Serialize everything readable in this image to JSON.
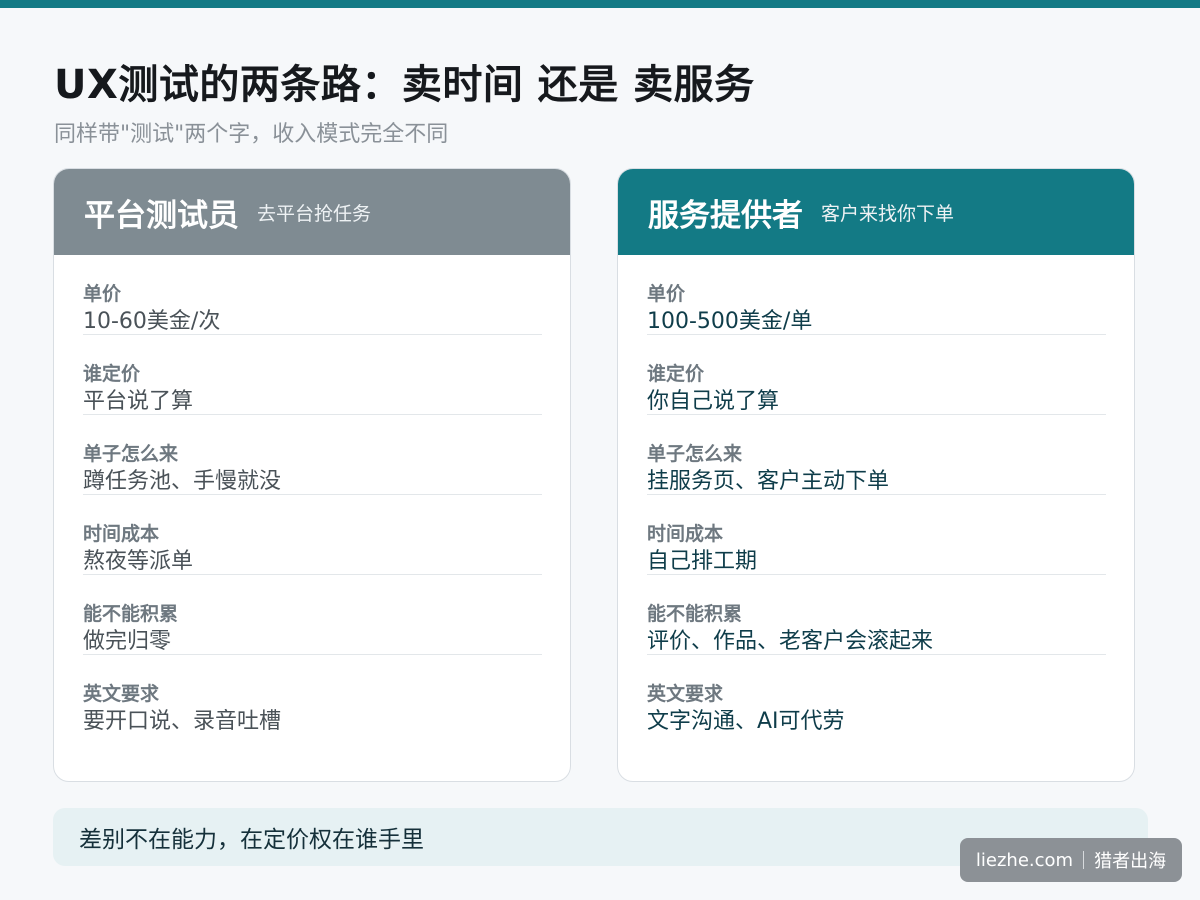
{
  "title": "UX测试的两条路：卖时间 还是 卖服务",
  "subtitle": "同样带\"测试\"两个字，收入模式完全不同",
  "cards": [
    {
      "title": "平台测试员",
      "note": "去平台抢任务",
      "rows": [
        {
          "label": "单价",
          "value": "10-60美金/次"
        },
        {
          "label": "谁定价",
          "value": "平台说了算"
        },
        {
          "label": "单子怎么来",
          "value": "蹲任务池、手慢就没"
        },
        {
          "label": "时间成本",
          "value": "熬夜等派单"
        },
        {
          "label": "能不能积累",
          "value": "做完归零"
        },
        {
          "label": "英文要求",
          "value": "要开口说、录音吐槽"
        }
      ]
    },
    {
      "title": "服务提供者",
      "note": "客户来找你下单",
      "rows": [
        {
          "label": "单价",
          "value": "100-500美金/单"
        },
        {
          "label": "谁定价",
          "value": "你自己说了算"
        },
        {
          "label": "单子怎么来",
          "value": "挂服务页、客户主动下单"
        },
        {
          "label": "时间成本",
          "value": "自己排工期"
        },
        {
          "label": "能不能积累",
          "value": "评价、作品、老客户会滚起来"
        },
        {
          "label": "英文要求",
          "value": "文字沟通、AI可代劳"
        }
      ]
    }
  ],
  "footer": "差别不在能力，在定价权在谁手里",
  "watermark": {
    "site": "liezhe.com",
    "brand": "猎者出海"
  },
  "colors": {
    "accent": "#137a85",
    "muted_header": "#7f8b92",
    "footer_bg": "#e6f1f3"
  }
}
